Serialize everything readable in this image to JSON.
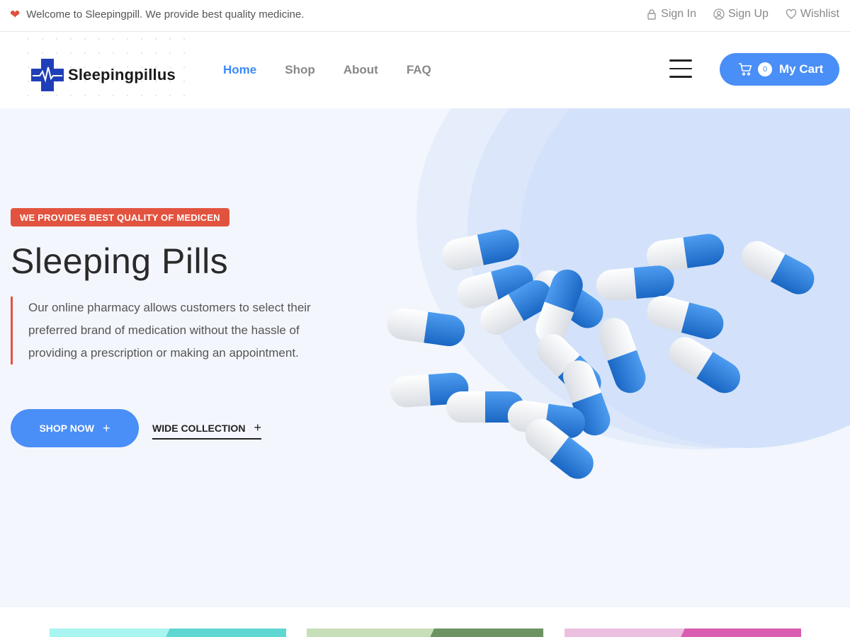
{
  "topbar": {
    "welcome": "Welcome to Sleepingpill. We provide best quality medicine.",
    "links": [
      {
        "label": "Sign In",
        "icon": "lock-icon"
      },
      {
        "label": "Sign Up",
        "icon": "user-circle-icon"
      },
      {
        "label": "Wishlist",
        "icon": "heart-outline-icon"
      }
    ]
  },
  "header": {
    "logo_text": "Sleepingpillus",
    "nav": [
      {
        "label": "Home",
        "active": true
      },
      {
        "label": "Shop",
        "active": false
      },
      {
        "label": "About",
        "active": false
      },
      {
        "label": "FAQ",
        "active": false
      }
    ],
    "cart": {
      "count": "0",
      "label": "My Cart"
    }
  },
  "hero": {
    "badge": "WE PROVIDES BEST QUALITY OF MEDICEN",
    "title": "Sleeping Pills",
    "description": "Our online pharmacy allows customers to select their preferred brand of medication without the hassle of providing a prescription or making an appointment.",
    "shop_button": "SHOP NOW",
    "collection_link": "WIDE COLLECTION"
  },
  "colors": {
    "accent": "#4a8ef7",
    "badge": "#e2533f",
    "hero_bg": "#f3f6fc"
  }
}
